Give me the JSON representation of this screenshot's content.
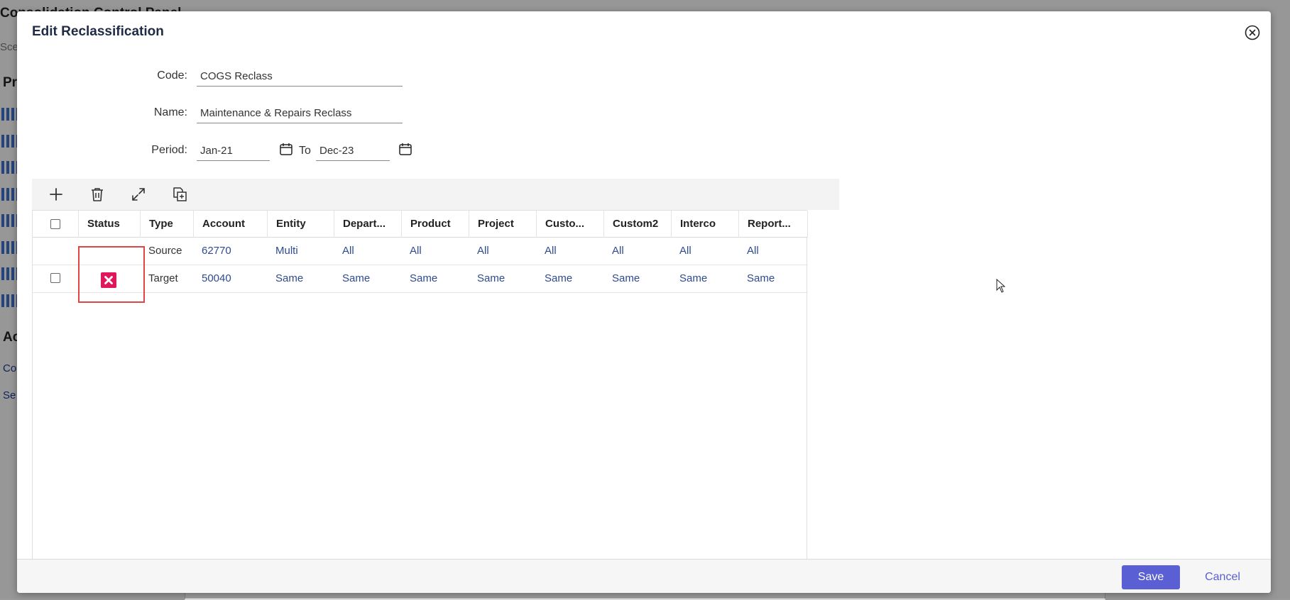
{
  "background": {
    "title": "Consolidation Control Panel",
    "search_text": "Sce",
    "heading_1": "Pr",
    "heading_2": "Ac",
    "link_1": "Co",
    "link_2": "Se"
  },
  "modal": {
    "title": "Edit Reclassification",
    "close_icon": "close-circle-icon"
  },
  "form": {
    "code_label": "Code:",
    "code_value": "COGS Reclass",
    "name_label": "Name:",
    "name_value": "Maintenance & Repairs Reclass",
    "period_label": "Period:",
    "period_from": "Jan-21",
    "to_label": "To",
    "period_to": "Dec-23"
  },
  "toolbar": {
    "icons": [
      "add-icon",
      "delete-icon",
      "expand-icon",
      "copy-icon"
    ]
  },
  "grid": {
    "columns": [
      "Status",
      "Type",
      "Account",
      "Entity",
      "Depart...",
      "Product",
      "Project",
      "Custo...",
      "Custom2",
      "Interco",
      "Report..."
    ],
    "rows": [
      {
        "type": "Source",
        "cells": [
          "62770",
          "Multi",
          "All",
          "All",
          "All",
          "All",
          "All",
          "All",
          "All"
        ]
      },
      {
        "type": "Target",
        "cells": [
          "50040",
          "Same",
          "Same",
          "Same",
          "Same",
          "Same",
          "Same",
          "Same",
          "Same"
        ]
      }
    ],
    "status_icon": "error-x-icon",
    "status_color": "#e0175a"
  },
  "footer": {
    "save_label": "Save",
    "cancel_label": "Cancel"
  },
  "colors": {
    "accent": "#5a5fd3",
    "link": "#2d4b8e",
    "error": "#e0175a",
    "highlight": "#e04545"
  }
}
